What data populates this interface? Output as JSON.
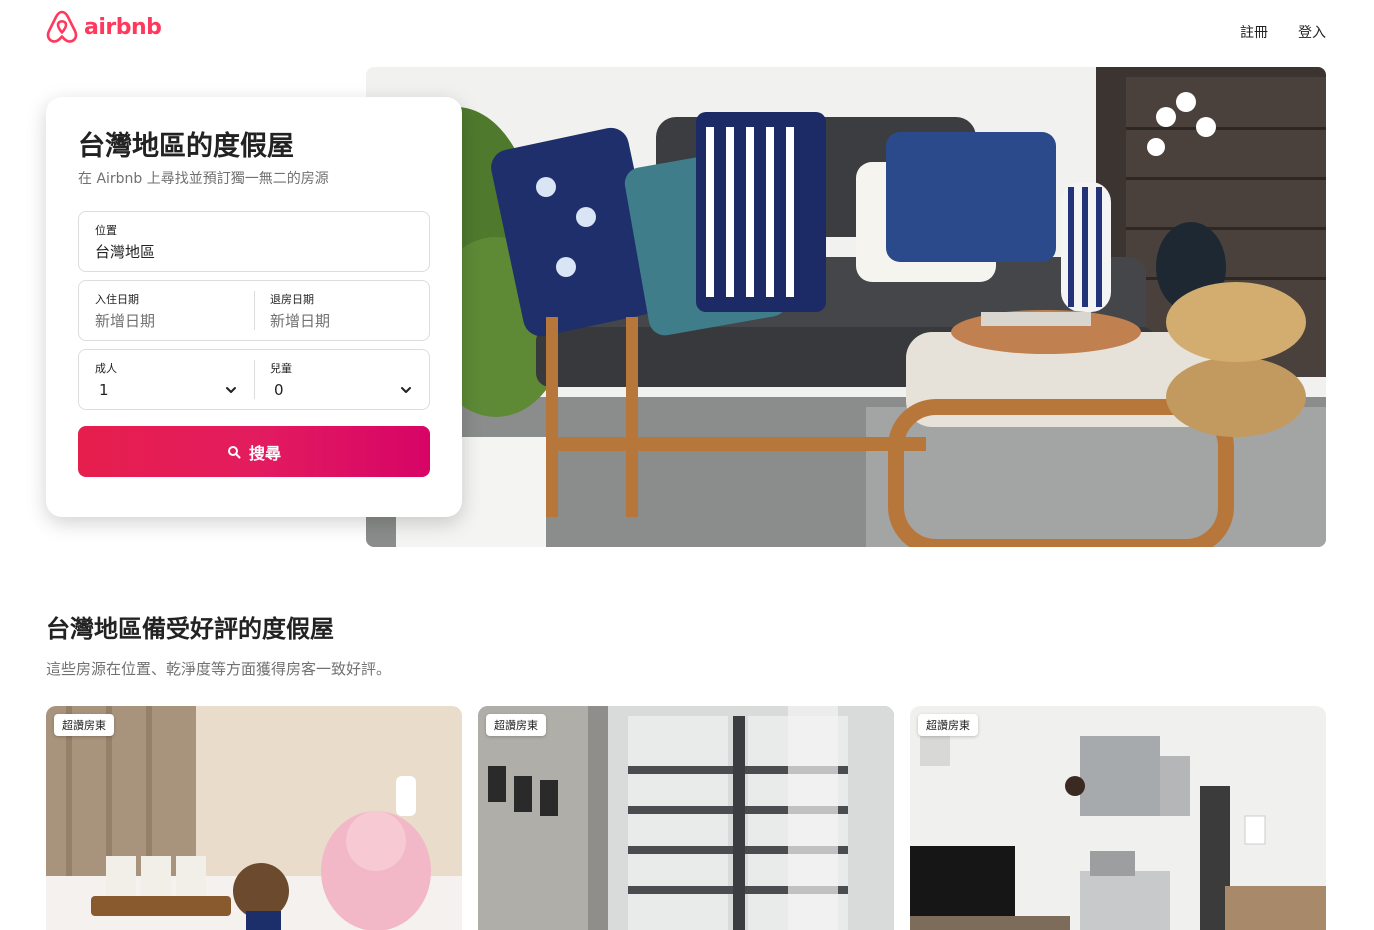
{
  "header": {
    "logo_text": "airbnb",
    "nav": {
      "signup": "註冊",
      "login": "登入"
    }
  },
  "search": {
    "title": "台灣地區的度假屋",
    "subtitle": "在 Airbnb 上尋找並預訂獨一無二的房源",
    "location_label": "位置",
    "location_value": "台灣地區",
    "checkin_label": "入住日期",
    "checkin_placeholder": "新增日期",
    "checkout_label": "退房日期",
    "checkout_placeholder": "新增日期",
    "adults_label": "成人",
    "adults_value": "1",
    "children_label": "兒童",
    "children_value": "0",
    "button_label": "搜尋"
  },
  "section": {
    "title": "台灣地區備受好評的度假屋",
    "subtitle": "這些房源在位置、乾淨度等方面獲得房客一致好評。"
  },
  "listings": [
    {
      "badge": "超讚房東"
    },
    {
      "badge": "超讚房東"
    },
    {
      "badge": "超讚房東"
    }
  ],
  "colors": {
    "brand": "#ff385c",
    "text": "#222222",
    "muted": "#717171"
  }
}
